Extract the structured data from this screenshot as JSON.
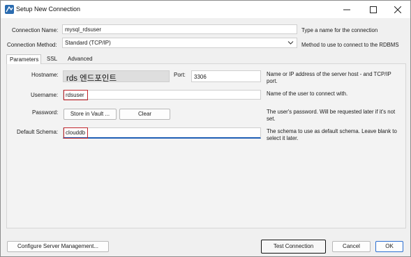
{
  "window": {
    "title": "Setup New Connection",
    "minimize_icon": "minimize-icon",
    "maximize_icon": "maximize-icon",
    "close_icon": "close-icon"
  },
  "connection_name": {
    "label": "Connection Name:",
    "value": "mysql_rdsuser",
    "hint": "Type a name for the connection"
  },
  "connection_method": {
    "label": "Connection Method:",
    "value": "Standard (TCP/IP)",
    "hint": "Method to use to connect to the RDBMS"
  },
  "tabs": [
    "Parameters",
    "SSL",
    "Advanced"
  ],
  "parameters": {
    "hostname": {
      "label": "Hostname:",
      "value": "rds 엔드포인트",
      "hint": "Name or IP address of the server host - and TCP/IP port."
    },
    "port": {
      "label": "Port:",
      "value": "3306"
    },
    "username": {
      "label": "Username:",
      "value": "rdsuser",
      "hint": "Name of the user to connect with."
    },
    "password": {
      "label": "Password:",
      "store_button": "Store in Vault ...",
      "clear_button": "Clear",
      "hint": "The user's password. Will be requested later if it's not set."
    },
    "default_schema": {
      "label": "Default Schema:",
      "value": "clouddb",
      "hint": "The schema to use as default schema. Leave blank to select it later."
    }
  },
  "footer": {
    "configure_button": "Configure Server Management...",
    "test_button": "Test Connection",
    "cancel_button": "Cancel",
    "ok_button": "OK"
  },
  "colors": {
    "highlight_red": "#c0262c",
    "focus_blue": "#1f5fb5",
    "ok_border": "#2c6fd1"
  }
}
